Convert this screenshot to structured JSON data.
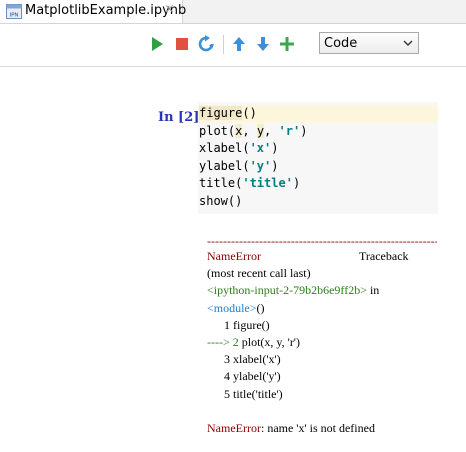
{
  "tab": {
    "title": "MatplotlibExample.ipynb",
    "icon": "ipynb-file-icon",
    "icon_text": "IPN",
    "close_label": "×"
  },
  "toolbar": {
    "run_icon": "run-icon",
    "stop_icon": "stop-icon",
    "restart_icon": "restart-kernel-icon",
    "move_up_icon": "arrow-up-icon",
    "move_down_icon": "arrow-down-icon",
    "add_icon": "plus-icon",
    "cell_type": "Code",
    "colors": {
      "run": "#2ea043",
      "stop": "#e0513f",
      "blue": "#3d8fd6",
      "green": "#3aa84a"
    }
  },
  "cell": {
    "prompt": "In [2]:",
    "code_lines": [
      {
        "a": "figure",
        "b": "()"
      },
      {
        "a": "plot(",
        "b": "x",
        "c": ", ",
        "d": "y",
        "e": ", ",
        "f": "'r'",
        "g": ")"
      },
      {
        "a": "xlabel(",
        "b": "'x'",
        "c": ")"
      },
      {
        "a": "ylabel(",
        "b": "'y'",
        "c": ")"
      },
      {
        "a": "title(",
        "b": "'title'",
        "c": ")"
      },
      {
        "a": "show()"
      }
    ]
  },
  "output": {
    "dashes": "---------------------------------------------------------------------------------------------------",
    "error_name": "NameError",
    "traceback_label": "Traceback",
    "recent_call": "(most recent call last)",
    "input_ref": "<ipython-input-2-79b2b6e9ff2b>",
    "in_word": " in",
    "module_ref": "<module>",
    "module_paren": "()",
    "lines": [
      {
        "prefix": "1 ",
        "text": "figure()"
      },
      {
        "prefix": "----> 2 ",
        "text": "plot(x, y, 'r')"
      },
      {
        "prefix": "3 ",
        "text": "xlabel('x')"
      },
      {
        "prefix": "4 ",
        "text": "ylabel('y')"
      },
      {
        "prefix": "5 ",
        "text": "title('title')"
      }
    ],
    "final_error_name": "NameError",
    "final_error_msg": ": name 'x' is not defined"
  }
}
